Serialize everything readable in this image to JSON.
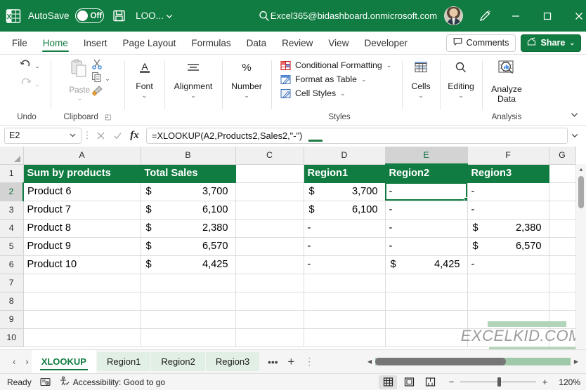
{
  "titlebar": {
    "app_icon": "excel-app-icon",
    "autosave_label": "AutoSave",
    "autosave_state": "Off",
    "save_icon": "save-icon",
    "filename": "LOO...",
    "filename_chevron": "chevron-down-icon",
    "search_icon": "search-icon",
    "account_email": "Excel365@bidashboard.onmicrosoft.com",
    "pen_icon": "pen-feedback-icon",
    "minimize": "minimize-icon",
    "maximize": "maximize-icon",
    "close": "close-icon",
    "bg_color": "#107C41"
  },
  "ribbon_tabs": [
    {
      "label": "File",
      "active": false
    },
    {
      "label": "Home",
      "active": true
    },
    {
      "label": "Insert",
      "active": false
    },
    {
      "label": "Page Layout",
      "active": false
    },
    {
      "label": "Formulas",
      "active": false
    },
    {
      "label": "Data",
      "active": false
    },
    {
      "label": "Review",
      "active": false
    },
    {
      "label": "View",
      "active": false
    },
    {
      "label": "Developer",
      "active": false
    }
  ],
  "tabstrip_right": {
    "comments_label": "Comments",
    "comments_icon": "comment-icon",
    "share_label": "Share",
    "share_icon": "share-icon",
    "share_chevron": "chevron-down-icon"
  },
  "ribbon": {
    "collapse_icon": "chevron-down-icon",
    "groups": [
      {
        "name": "undo",
        "label": "Undo",
        "buttons": [
          {
            "name": "undo",
            "icon": "undo-arrow-icon",
            "chevron": true
          },
          {
            "name": "redo",
            "icon": "redo-arrow-icon",
            "chevron": true,
            "disabled": true
          }
        ]
      },
      {
        "name": "clipboard",
        "label": "Clipboard",
        "dialog_launcher": "dialog-launcher-icon",
        "paste_label": "Paste",
        "buttons": [
          {
            "name": "cut",
            "icon": "scissors-icon"
          },
          {
            "name": "copy",
            "icon": "copy-icon",
            "chevron": true
          },
          {
            "name": "format-painter",
            "icon": "format-painter-icon"
          }
        ]
      },
      {
        "name": "font",
        "label": "Font",
        "icon": "font-a-icon",
        "chevron": true
      },
      {
        "name": "alignment",
        "label": "Alignment",
        "icon": "alignment-lines-icon",
        "chevron": true
      },
      {
        "name": "number",
        "label": "Number",
        "icon": "percent-icon",
        "chevron": true
      },
      {
        "name": "styles",
        "label": "Styles",
        "items": [
          {
            "label": "Conditional Formatting",
            "icon": "conditional-formatting-icon",
            "chevron": true
          },
          {
            "label": "Format as Table",
            "icon": "format-as-table-icon",
            "chevron": true
          },
          {
            "label": "Cell Styles",
            "icon": "cell-styles-icon",
            "chevron": true
          }
        ]
      },
      {
        "name": "cells",
        "label": "",
        "button_label": "Cells",
        "icon": "cells-insert-icon",
        "chevron": true
      },
      {
        "name": "editing",
        "label": "",
        "button_label": "Editing",
        "icon": "editing-magnifier-icon",
        "chevron": true
      },
      {
        "name": "analysis",
        "label": "Analysis",
        "button_label_line1": "Analyze",
        "button_label_line2": "Data",
        "icon": "analyze-data-icon"
      }
    ]
  },
  "formula_bar": {
    "namebox_value": "E2",
    "namebox_chevron": "chevron-down-icon",
    "dots_icon": "vertical-dots-icon",
    "cancel_icon": "cancel-x-icon",
    "confirm_icon": "confirm-check-icon",
    "fx_label": "fx",
    "formula": "=XLOOKUP(A2,Products2,Sales2,\"-\")",
    "expand_icon": "chevron-down-icon"
  },
  "sheet": {
    "column_headers": [
      "A",
      "B",
      "C",
      "D",
      "E",
      "F",
      "G"
    ],
    "selected_column": "E",
    "selected_cell": "E2",
    "row_headers": [
      "1",
      "2",
      "3",
      "4",
      "5",
      "6",
      "7",
      "8",
      "9",
      "10"
    ],
    "selected_row": "2",
    "header_row": {
      "A": "Sum by products",
      "B": "Total Sales",
      "C": "",
      "D": "Region1",
      "E": "Region2",
      "F": "Region3",
      "G": ""
    },
    "rows": [
      {
        "row": "2",
        "A": "Product 6",
        "B_sym": "$",
        "B": "3,700",
        "C": "",
        "D_sym": "$",
        "D": "3,700",
        "E_sym": "",
        "E": "-",
        "F_sym": "",
        "F": "-"
      },
      {
        "row": "3",
        "A": "Product 7",
        "B_sym": "$",
        "B": "6,100",
        "C": "",
        "D_sym": "$",
        "D": "6,100",
        "E_sym": "",
        "E": "-",
        "F_sym": "",
        "F": "-"
      },
      {
        "row": "4",
        "A": "Product 8",
        "B_sym": "$",
        "B": "2,380",
        "C": "",
        "D_sym": "",
        "D": "-",
        "E_sym": "",
        "E": "-",
        "F_sym": "$",
        "F": "2,380"
      },
      {
        "row": "5",
        "A": "Product 9",
        "B_sym": "$",
        "B": "6,570",
        "C": "",
        "D_sym": "",
        "D": "-",
        "E_sym": "",
        "E": "-",
        "F_sym": "$",
        "F": "6,570"
      },
      {
        "row": "6",
        "A": "Product 10",
        "B_sym": "$",
        "B": "4,425",
        "C": "",
        "D_sym": "",
        "D": "-",
        "E_sym": "$",
        "E": "4,425",
        "F_sym": "",
        "F": "-"
      },
      {
        "row": "7",
        "A": "",
        "B_sym": "",
        "B": "",
        "C": "",
        "D_sym": "",
        "D": "",
        "E_sym": "",
        "E": "",
        "F_sym": "",
        "F": ""
      },
      {
        "row": "8",
        "A": "",
        "B_sym": "",
        "B": "",
        "C": "",
        "D_sym": "",
        "D": "",
        "E_sym": "",
        "E": "",
        "F_sym": "",
        "F": ""
      },
      {
        "row": "9",
        "A": "",
        "B_sym": "",
        "B": "",
        "C": "",
        "D_sym": "",
        "D": "",
        "E_sym": "",
        "E": "",
        "F_sym": "",
        "F": ""
      },
      {
        "row": "10",
        "A": "",
        "B_sym": "",
        "B": "",
        "C": "",
        "D_sym": "",
        "D": "",
        "E_sym": "",
        "E": "",
        "F_sym": "",
        "F": ""
      }
    ],
    "header_fill_color": "#107C41",
    "watermark": "EXCELKID.COM"
  },
  "sheet_tabs": {
    "prev_icon": "chevron-left-icon",
    "next_icon": "chevron-right-icon",
    "tabs": [
      {
        "label": "XLOOKUP",
        "active": true
      },
      {
        "label": "Region1",
        "active": false
      },
      {
        "label": "Region2",
        "active": false
      },
      {
        "label": "Region3",
        "active": false
      }
    ],
    "more_icon": "ellipsis-icon",
    "add_icon": "plus-icon",
    "options_icon": "vertical-dots-icon"
  },
  "status_bar": {
    "status": "Ready",
    "macro_icon": "record-macro-icon",
    "accessibility_icon": "accessibility-icon",
    "accessibility_label": "Accessibility: Good to go",
    "views": [
      {
        "name": "normal-view",
        "icon": "grid-view-icon",
        "active": true
      },
      {
        "name": "page-layout-view",
        "icon": "page-layout-icon",
        "active": false
      },
      {
        "name": "page-break-view",
        "icon": "page-break-icon",
        "active": false
      }
    ],
    "zoom_out": "−",
    "zoom_in": "+",
    "zoom_level": "120%"
  }
}
